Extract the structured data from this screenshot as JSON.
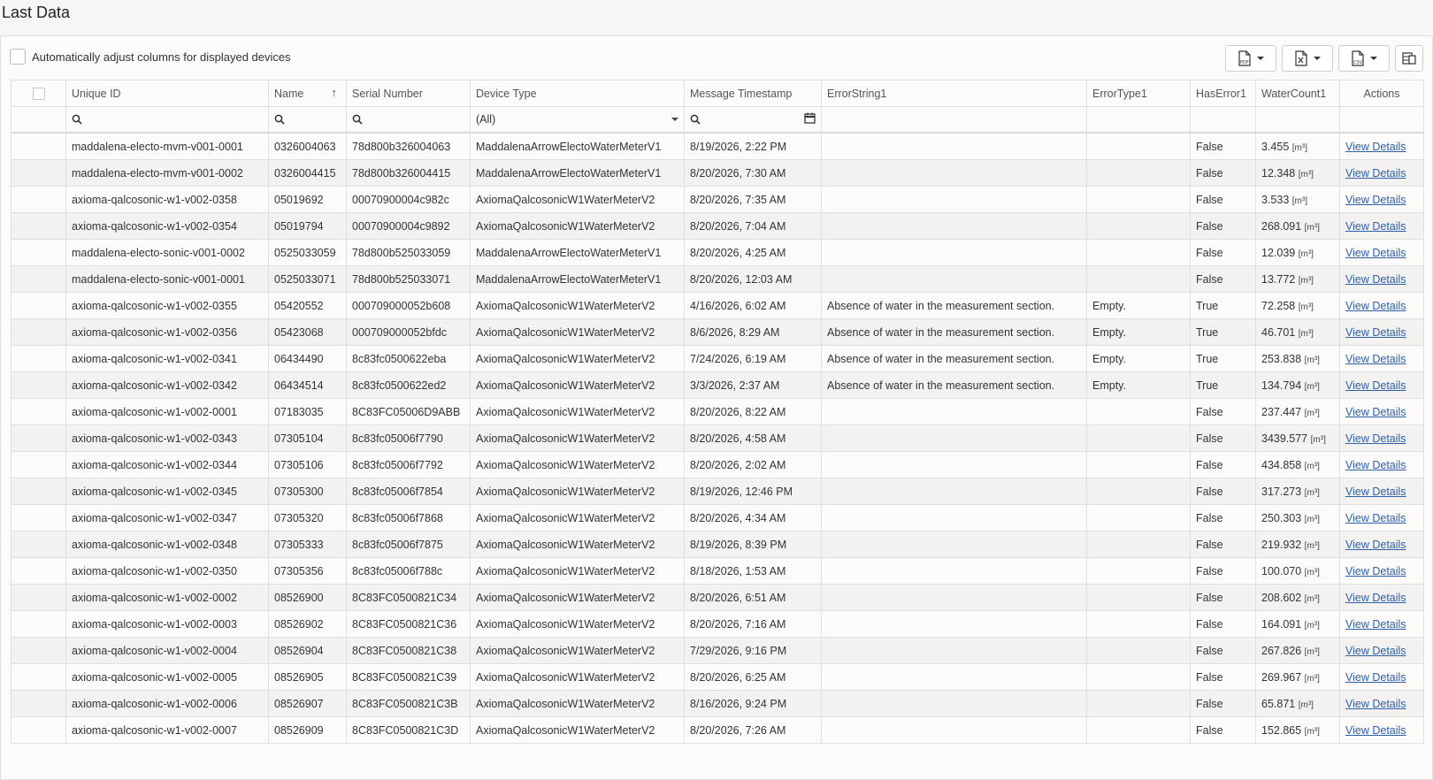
{
  "page": {
    "title": "Last Data"
  },
  "toolbar": {
    "auto_adjust_label": "Automatically adjust columns for displayed devices",
    "export_pdf_icon": "pdf-export-icon",
    "export_excel_icon": "excel-export-icon",
    "export_csv_icon": "csv-export-icon",
    "column_chooser_icon": "column-chooser-icon"
  },
  "grid": {
    "columns": [
      "Unique ID",
      "Name",
      "Serial Number",
      "Device Type",
      "Message Timestamp",
      "ErrorString1",
      "ErrorType1",
      "HasError1",
      "WaterCount1",
      "Actions"
    ],
    "filters": {
      "device_type": "(All)"
    },
    "unit": "[m³]",
    "action_label": "View Details",
    "rows": [
      [
        "maddalena-electo-mvm-v001-0001",
        "0326004063",
        "78d800b326004063",
        "MaddalenaArrowElectoWaterMeterV1",
        "8/19/2026, 2:22 PM",
        "",
        "",
        "False",
        "3.455"
      ],
      [
        "maddalena-electo-mvm-v001-0002",
        "0326004415",
        "78d800b326004415",
        "MaddalenaArrowElectoWaterMeterV1",
        "8/20/2026, 7:30 AM",
        "",
        "",
        "False",
        "12.348"
      ],
      [
        "axioma-qalcosonic-w1-v002-0358",
        "05019692",
        "00070900004c982c",
        "AxiomaQalcosonicW1WaterMeterV2",
        "8/20/2026, 7:35 AM",
        "",
        "",
        "False",
        "3.533"
      ],
      [
        "axioma-qalcosonic-w1-v002-0354",
        "05019794",
        "00070900004c9892",
        "AxiomaQalcosonicW1WaterMeterV2",
        "8/20/2026, 7:04 AM",
        "",
        "",
        "False",
        "268.091"
      ],
      [
        "maddalena-electo-sonic-v001-0002",
        "0525033059",
        "78d800b525033059",
        "MaddalenaArrowElectoWaterMeterV1",
        "8/20/2026, 4:25 AM",
        "",
        "",
        "False",
        "12.039"
      ],
      [
        "maddalena-electo-sonic-v001-0001",
        "0525033071",
        "78d800b525033071",
        "MaddalenaArrowElectoWaterMeterV1",
        "8/20/2026, 12:03 AM",
        "",
        "",
        "False",
        "13.772"
      ],
      [
        "axioma-qalcosonic-w1-v002-0355",
        "05420552",
        "000709000052b608",
        "AxiomaQalcosonicW1WaterMeterV2",
        "4/16/2026, 6:02 AM",
        "Absence of water in the measurement section.",
        "Empty.",
        "True",
        "72.258"
      ],
      [
        "axioma-qalcosonic-w1-v002-0356",
        "05423068",
        "000709000052bfdc",
        "AxiomaQalcosonicW1WaterMeterV2",
        "8/6/2026, 8:29 AM",
        "Absence of water in the measurement section.",
        "Empty.",
        "True",
        "46.701"
      ],
      [
        "axioma-qalcosonic-w1-v002-0341",
        "06434490",
        "8c83fc0500622eba",
        "AxiomaQalcosonicW1WaterMeterV2",
        "7/24/2026, 6:19 AM",
        "Absence of water in the measurement section.",
        "Empty.",
        "True",
        "253.838"
      ],
      [
        "axioma-qalcosonic-w1-v002-0342",
        "06434514",
        "8c83fc0500622ed2",
        "AxiomaQalcosonicW1WaterMeterV2",
        "3/3/2026, 2:37 AM",
        "Absence of water in the measurement section.",
        "Empty.",
        "True",
        "134.794"
      ],
      [
        "axioma-qalcosonic-w1-v002-0001",
        "07183035",
        "8C83FC05006D9ABB",
        "AxiomaQalcosonicW1WaterMeterV2",
        "8/20/2026, 8:22 AM",
        "",
        "",
        "False",
        "237.447"
      ],
      [
        "axioma-qalcosonic-w1-v002-0343",
        "07305104",
        "8c83fc05006f7790",
        "AxiomaQalcosonicW1WaterMeterV2",
        "8/20/2026, 4:58 AM",
        "",
        "",
        "False",
        "3439.577"
      ],
      [
        "axioma-qalcosonic-w1-v002-0344",
        "07305106",
        "8c83fc05006f7792",
        "AxiomaQalcosonicW1WaterMeterV2",
        "8/20/2026, 2:02 AM",
        "",
        "",
        "False",
        "434.858"
      ],
      [
        "axioma-qalcosonic-w1-v002-0345",
        "07305300",
        "8c83fc05006f7854",
        "AxiomaQalcosonicW1WaterMeterV2",
        "8/19/2026, 12:46 PM",
        "",
        "",
        "False",
        "317.273"
      ],
      [
        "axioma-qalcosonic-w1-v002-0347",
        "07305320",
        "8c83fc05006f7868",
        "AxiomaQalcosonicW1WaterMeterV2",
        "8/20/2026, 4:34 AM",
        "",
        "",
        "False",
        "250.303"
      ],
      [
        "axioma-qalcosonic-w1-v002-0348",
        "07305333",
        "8c83fc05006f7875",
        "AxiomaQalcosonicW1WaterMeterV2",
        "8/19/2026, 8:39 PM",
        "",
        "",
        "False",
        "219.932"
      ],
      [
        "axioma-qalcosonic-w1-v002-0350",
        "07305356",
        "8c83fc05006f788c",
        "AxiomaQalcosonicW1WaterMeterV2",
        "8/18/2026, 1:53 AM",
        "",
        "",
        "False",
        "100.070"
      ],
      [
        "axioma-qalcosonic-w1-v002-0002",
        "08526900",
        "8C83FC0500821C34",
        "AxiomaQalcosonicW1WaterMeterV2",
        "8/20/2026, 6:51 AM",
        "",
        "",
        "False",
        "208.602"
      ],
      [
        "axioma-qalcosonic-w1-v002-0003",
        "08526902",
        "8C83FC0500821C36",
        "AxiomaQalcosonicW1WaterMeterV2",
        "8/20/2026, 7:16 AM",
        "",
        "",
        "False",
        "164.091"
      ],
      [
        "axioma-qalcosonic-w1-v002-0004",
        "08526904",
        "8C83FC0500821C38",
        "AxiomaQalcosonicW1WaterMeterV2",
        "7/29/2026, 9:16 PM",
        "",
        "",
        "False",
        "267.826"
      ],
      [
        "axioma-qalcosonic-w1-v002-0005",
        "08526905",
        "8C83FC0500821C39",
        "AxiomaQalcosonicW1WaterMeterV2",
        "8/20/2026, 6:25 AM",
        "",
        "",
        "False",
        "269.967"
      ],
      [
        "axioma-qalcosonic-w1-v002-0006",
        "08526907",
        "8C83FC0500821C3B",
        "AxiomaQalcosonicW1WaterMeterV2",
        "8/16/2026, 9:24 PM",
        "",
        "",
        "False",
        "65.871"
      ],
      [
        "axioma-qalcosonic-w1-v002-0007",
        "08526909",
        "8C83FC0500821C3D",
        "AxiomaQalcosonicW1WaterMeterV2",
        "8/20/2026, 7:26 AM",
        "",
        "",
        "False",
        "152.865"
      ]
    ]
  }
}
